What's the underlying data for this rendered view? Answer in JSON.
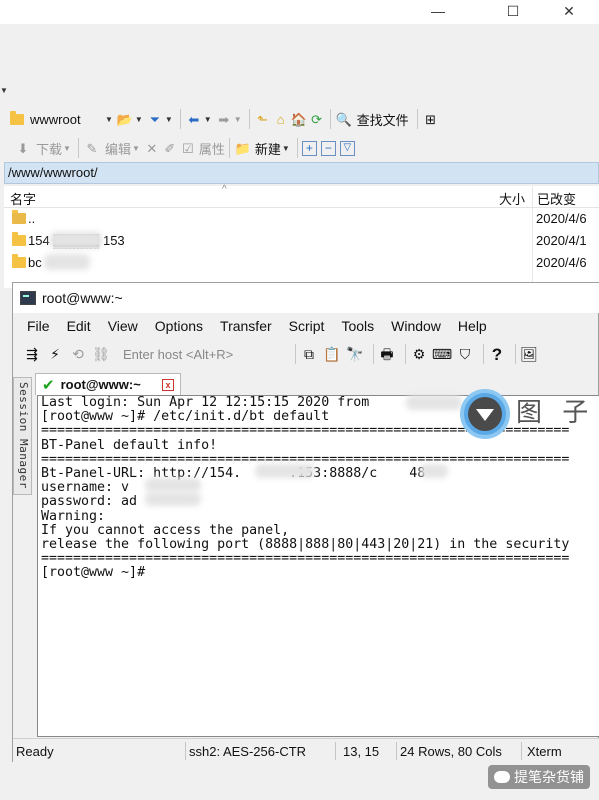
{
  "file_manager": {
    "window_controls": {
      "minimize": "—",
      "maximize": "☐",
      "close": "✕"
    },
    "toolbar1": {
      "location": "wwwroot",
      "find_files_label": "查找文件"
    },
    "toolbar2": {
      "download_label": "下载",
      "edit_label": "编辑",
      "properties_label": "属性",
      "new_label": "新建"
    },
    "path": "/www/wwwroot/",
    "columns": {
      "name": "名字",
      "size": "大小",
      "modified": "已改变"
    },
    "rows": [
      {
        "name": "..",
        "date": "2020/4/6"
      },
      {
        "name": "154 ▒▒▒▒▒ 153",
        "date": "2020/4/1"
      },
      {
        "name": "bc",
        "date": "2020/4/6"
      }
    ]
  },
  "terminal_window": {
    "title": "root@www:~",
    "menu": [
      "File",
      "Edit",
      "View",
      "Options",
      "Transfer",
      "Script",
      "Tools",
      "Window",
      "Help"
    ],
    "quick_connect_placeholder": "Enter host <Alt+R>",
    "session_manager_label": "Session Manager",
    "tab_label": "root@www:~",
    "tab_close": "x",
    "terminal_text": "Last login: Sun Apr 12 12:15:15 2020 from\n[root@www ~]# /etc/init.d/bt default\n==================================================================\nBT-Panel default info!\n==================================================================\nBt-Panel-URL: http://154.      .153:8888/c    48\nusername: v\npassword: ad\nWarning:\nIf you cannot access the panel,\nrelease the following port (8888|888|80|443|20|21) in the security\n==================================================================\n[root@www ~]#",
    "status": {
      "ready": "Ready",
      "cipher": "ssh2: AES-256-CTR",
      "cursor": "13, 15",
      "size": "24 Rows, 80 Cols",
      "emulation": "Xterm"
    }
  },
  "watermarks": {
    "circle_text": "图 子",
    "footer_text": "提笔杂货铺"
  }
}
